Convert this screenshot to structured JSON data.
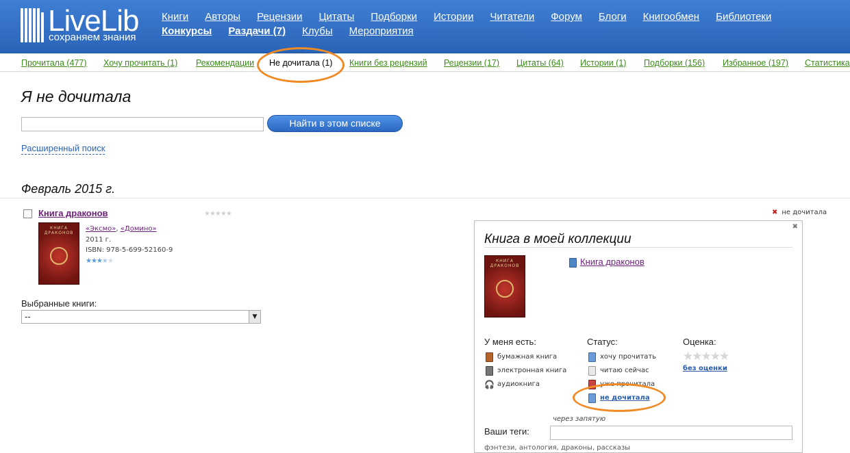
{
  "header": {
    "logo_title": "LiveLib",
    "logo_subtitle": "сохраняем знания",
    "nav_row1": [
      "Книги",
      "Авторы",
      "Рецензии",
      "Цитаты",
      "Подборки",
      "Истории",
      "Читатели",
      "Форум",
      "Блоги",
      "Книгообмен",
      "Библиотеки"
    ],
    "nav_row2": [
      "Конкурсы",
      "Раздачи (7)",
      "Клубы",
      "Мероприятия"
    ]
  },
  "tabs": [
    "Прочитала (477)",
    "Хочу прочитать (1)",
    "Рекомендации",
    "Не дочитала (1)",
    "Книги без рецензий",
    "Рецензии (17)",
    "Цитаты (64)",
    "Истории (1)",
    "Подборки (156)",
    "Избранное (197)",
    "Статистика"
  ],
  "page": {
    "title": "Я не дочитала",
    "search_button": "Найти в этом списке",
    "advanced_search": "Расширенный поиск",
    "month": "Февраль 2015 г."
  },
  "book": {
    "title": "Книга драконов",
    "publisher1": "«Эксмо»",
    "publisher_sep": ", ",
    "publisher2": "«Домино»",
    "year": "2011 г.",
    "isbn": "ISBN: 978-5-699-52160-9",
    "rating": 3.5,
    "cover_text": "КНИГА ДРАКОНОВ",
    "status": "не дочитала"
  },
  "chosen": {
    "label": "Выбранные книги:",
    "value": "--"
  },
  "popup": {
    "title": "Книга в моей коллекции",
    "book_title": "Книга драконов",
    "have_header": "У меня есть:",
    "have": [
      "бумажная книга",
      "электронная книга",
      "аудиокнига"
    ],
    "status_header": "Статус:",
    "status": [
      "хочу прочитать",
      "читаю сейчас",
      "уже прочитала",
      "не дочитала"
    ],
    "rating_header": "Оценка:",
    "no_rating": "без оценки",
    "comma_hint": "через запятую",
    "tags_label": "Ваши теги:",
    "tag_suggestions": "фэнтези, антология, драконы, рассказы"
  },
  "colors": {
    "header_blue": "#2f6fc6",
    "tab_green": "#3c8a1a",
    "highlight_orange": "#f08a24",
    "link_purple": "#6d1d7a"
  }
}
